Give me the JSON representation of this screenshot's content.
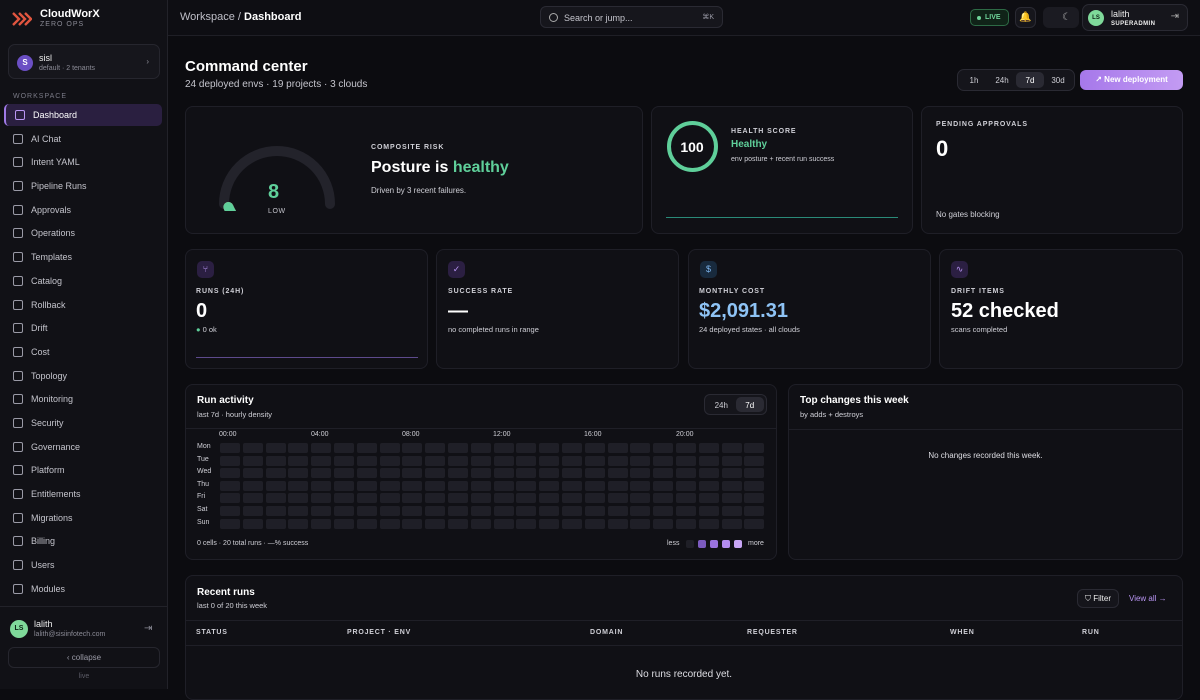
{
  "brand": {
    "name": "CloudWorX",
    "tagline": "ZERO OPS"
  },
  "tenant": {
    "initial": "S",
    "name": "sisl",
    "detail": "default · 2 tenants"
  },
  "sidebar": {
    "section_label": "WORKSPACE",
    "items": [
      {
        "label": "Dashboard",
        "icon": "grid-icon"
      },
      {
        "label": "AI Chat",
        "icon": "chat-icon"
      },
      {
        "label": "Intent YAML",
        "icon": "file-icon"
      },
      {
        "label": "Pipeline Runs",
        "icon": "branch-icon"
      },
      {
        "label": "Approvals",
        "icon": "shield-check-icon"
      },
      {
        "label": "Operations",
        "icon": "wrench-icon"
      },
      {
        "label": "Templates",
        "icon": "template-icon"
      },
      {
        "label": "Catalog",
        "icon": "book-icon"
      },
      {
        "label": "Rollback",
        "icon": "rollback-icon"
      },
      {
        "label": "Drift",
        "icon": "activity-icon"
      },
      {
        "label": "Cost",
        "icon": "dollar-icon"
      },
      {
        "label": "Topology",
        "icon": "topology-icon"
      },
      {
        "label": "Monitoring",
        "icon": "gauge-icon"
      },
      {
        "label": "Security",
        "icon": "shield-icon"
      },
      {
        "label": "Governance",
        "icon": "scale-icon"
      },
      {
        "label": "Platform",
        "icon": "building-icon"
      },
      {
        "label": "Entitlements",
        "icon": "key-icon"
      },
      {
        "label": "Migrations",
        "icon": "swap-icon"
      },
      {
        "label": "Billing",
        "icon": "card-icon"
      },
      {
        "label": "Users",
        "icon": "users-icon"
      },
      {
        "label": "Modules",
        "icon": "box-icon"
      }
    ]
  },
  "user": {
    "initials": "LS",
    "name": "lalith",
    "email": "lalith@sisiinfotech.com",
    "role": "SUPERADMIN"
  },
  "collapse_label": "‹  collapse",
  "footer_status": "live",
  "header": {
    "crumb_root": "Workspace",
    "crumb_sep": "/",
    "crumb_page": "Dashboard",
    "search_placeholder": "Search or jump...",
    "search_shortcut": "⌘K",
    "live_label": "LIVE"
  },
  "page": {
    "title": "Command center",
    "subtitle": "24 deployed envs · 19 projects · 3 clouds"
  },
  "ranges": [
    "1h",
    "24h",
    "7d",
    "30d"
  ],
  "active_range": "7d",
  "new_deployment_label": "New deployment",
  "risk": {
    "score": "8",
    "level": "LOW",
    "score_value": 8,
    "score_max": 100,
    "label": "COMPOSITE RISK",
    "title_prefix": "Posture is",
    "title_state": "healthy",
    "detail": "Driven by 3 recent failures."
  },
  "health": {
    "value": "100",
    "label": "HEALTH SCORE",
    "state": "Healthy",
    "detail": "env posture + recent run success"
  },
  "approvals": {
    "label": "PENDING APPROVALS",
    "value": "0",
    "detail": "No gates blocking"
  },
  "kpis": [
    {
      "label": "RUNS (24H)",
      "value": "0",
      "detail": "0 ok",
      "icon": "branch-icon",
      "color": "#b995f3"
    },
    {
      "label": "SUCCESS RATE",
      "value": "—",
      "detail": "no completed runs in range",
      "icon": "check-icon",
      "color": "#b995f3"
    },
    {
      "label": "MONTHLY COST",
      "value": "$2,091.31",
      "detail": "24 deployed states · all clouds",
      "icon": "dollar-icon",
      "color": "#7fb6ee"
    },
    {
      "label": "DRIFT ITEMS",
      "value": "52 checked",
      "detail": "scans completed",
      "icon": "activity-icon",
      "color": "#b995f3"
    }
  ],
  "activity": {
    "title": "Run activity",
    "subtitle": "last 7d · hourly density",
    "tabs": [
      "24h",
      "7d"
    ],
    "active_tab": "7d",
    "hours": [
      "00:00",
      "04:00",
      "08:00",
      "12:00",
      "16:00",
      "20:00"
    ],
    "days": [
      "Mon",
      "Tue",
      "Wed",
      "Thu",
      "Fri",
      "Sat",
      "Sun"
    ],
    "summary": "0 cells · 20 total runs · —% success",
    "legend_less": "less",
    "legend_more": "more"
  },
  "changes": {
    "title": "Top changes this week",
    "subtitle": "by adds + destroys",
    "empty": "No changes recorded this week."
  },
  "recent": {
    "title": "Recent runs",
    "subtitle": "last 0 of 20 this week",
    "filter": "Filter",
    "view_all": "View all",
    "columns": [
      "STATUS",
      "PROJECT · ENV",
      "DOMAIN",
      "REQUESTER",
      "WHEN",
      "RUN"
    ],
    "empty": "No runs recorded yet."
  }
}
